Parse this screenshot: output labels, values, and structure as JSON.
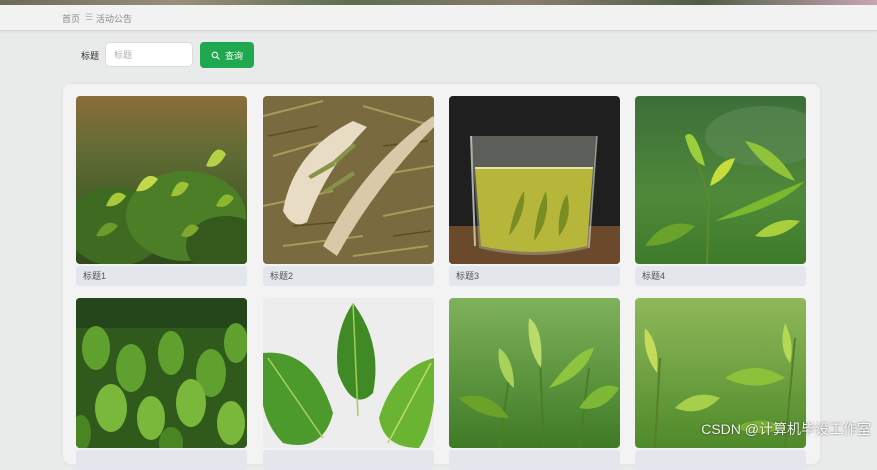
{
  "breadcrumb": {
    "home": "首页",
    "separator": "☰",
    "current": "活动公告"
  },
  "search": {
    "label": "标题",
    "placeholder": "标题",
    "value": "",
    "button_label": "查询"
  },
  "cards": [
    {
      "title": "标题1"
    },
    {
      "title": "标题2"
    },
    {
      "title": "标题3"
    },
    {
      "title": "标题4"
    },
    {
      "title": ""
    },
    {
      "title": ""
    },
    {
      "title": ""
    },
    {
      "title": ""
    }
  ],
  "watermark": "CSDN @计算机毕设工作室",
  "colors": {
    "accent": "#1fa84f",
    "caption_bg": "#e3e6ec",
    "page_bg": "#e9eaea"
  }
}
